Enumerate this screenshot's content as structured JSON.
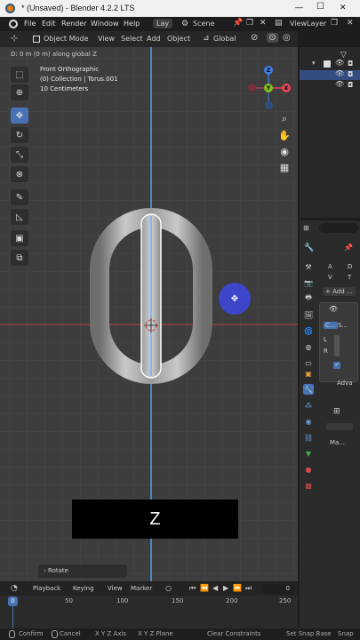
{
  "window": {
    "title": "* (Unsaved) - Blender 4.2.2 LTS",
    "minimize": "—",
    "maximize": "☐",
    "close": "✕"
  },
  "menubar": {
    "items": [
      "File",
      "Edit",
      "Render",
      "Window",
      "Help"
    ],
    "workspace_tab": "Lay",
    "scene_label": "Scene",
    "viewlayer_label": "ViewLayer"
  },
  "header3d": {
    "mode": "Object Mode",
    "menus": [
      "View",
      "Select",
      "Add",
      "Object"
    ],
    "transform_orientation": "Global"
  },
  "viewport": {
    "operator_hint": "D: 0 m (0 m) along global Z",
    "view_name": "Front Orthographic",
    "collection_info": "(0) Collection | Torus.001",
    "scale_info": "10 Centimeters",
    "axis_key_overlay": "Z",
    "last_operator": "Rotate",
    "gizmo_axes": {
      "x": "X",
      "y": "Y",
      "z": "Z"
    },
    "colors": {
      "x_axis": "#e0455a",
      "y_axis": "#7fbf22",
      "z_axis": "#3b7fe0",
      "background": "#3d3d3d",
      "cursor_blob": "#3d46c8"
    }
  },
  "properties": {
    "add_modifier": "+ Add ...",
    "labels": [
      "A",
      "D",
      "V",
      "T"
    ],
    "modifier_name": "C...",
    "modifier_name2": "S...",
    "row_labels": [
      "L",
      "R"
    ],
    "advanced": "Adva",
    "section2": "Ma..."
  },
  "timeline": {
    "menus": [
      "Playback",
      "Keying",
      "View",
      "Marker"
    ],
    "current_frame": "0",
    "ticks": [
      "0",
      "50",
      "100",
      "150",
      "200",
      "250"
    ]
  },
  "statusbar": {
    "items": [
      "Confirm",
      "Cancel",
      "X Y Z Axis",
      "X Y Z Plane",
      "Clear Constraints",
      "Set Snap Base",
      "Snap"
    ]
  }
}
